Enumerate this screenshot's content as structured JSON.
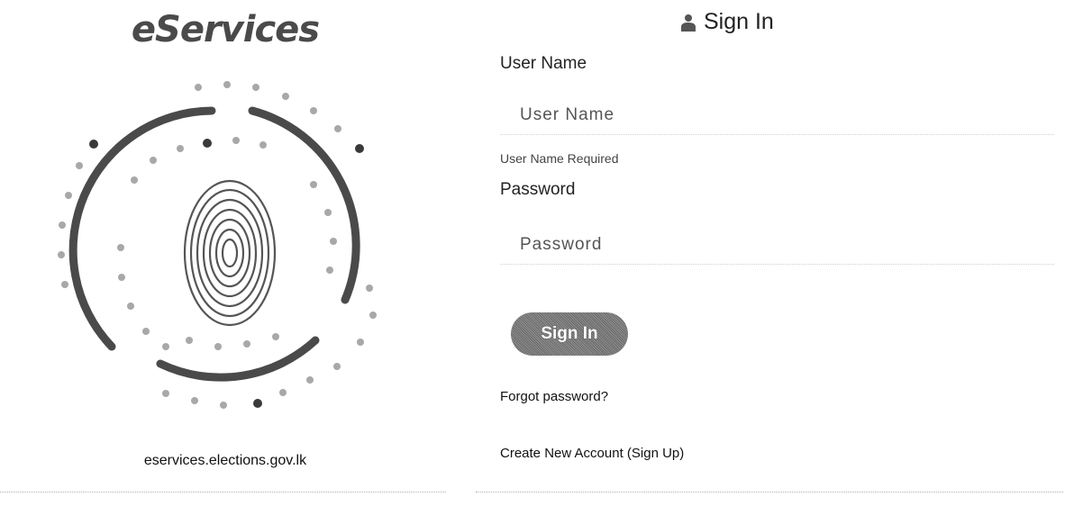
{
  "brand": {
    "name": "eServices",
    "site_url": "eservices.elections.gov.lk"
  },
  "form": {
    "title": "Sign In",
    "title_icon": "user-icon",
    "username": {
      "label": "User Name",
      "placeholder": "User Name",
      "value": "",
      "validation": "User Name Required"
    },
    "password": {
      "label": "Password",
      "placeholder": "Password",
      "value": ""
    },
    "submit_label": "Sign In",
    "forgot_link": "Forgot password?",
    "signup_link": "Create New Account (Sign Up)"
  },
  "colors": {
    "arc": "#4a4a4a",
    "dot_dark": "#3a3a3a",
    "dot_light": "#a8a8a8",
    "button": "#7a7a7a"
  }
}
